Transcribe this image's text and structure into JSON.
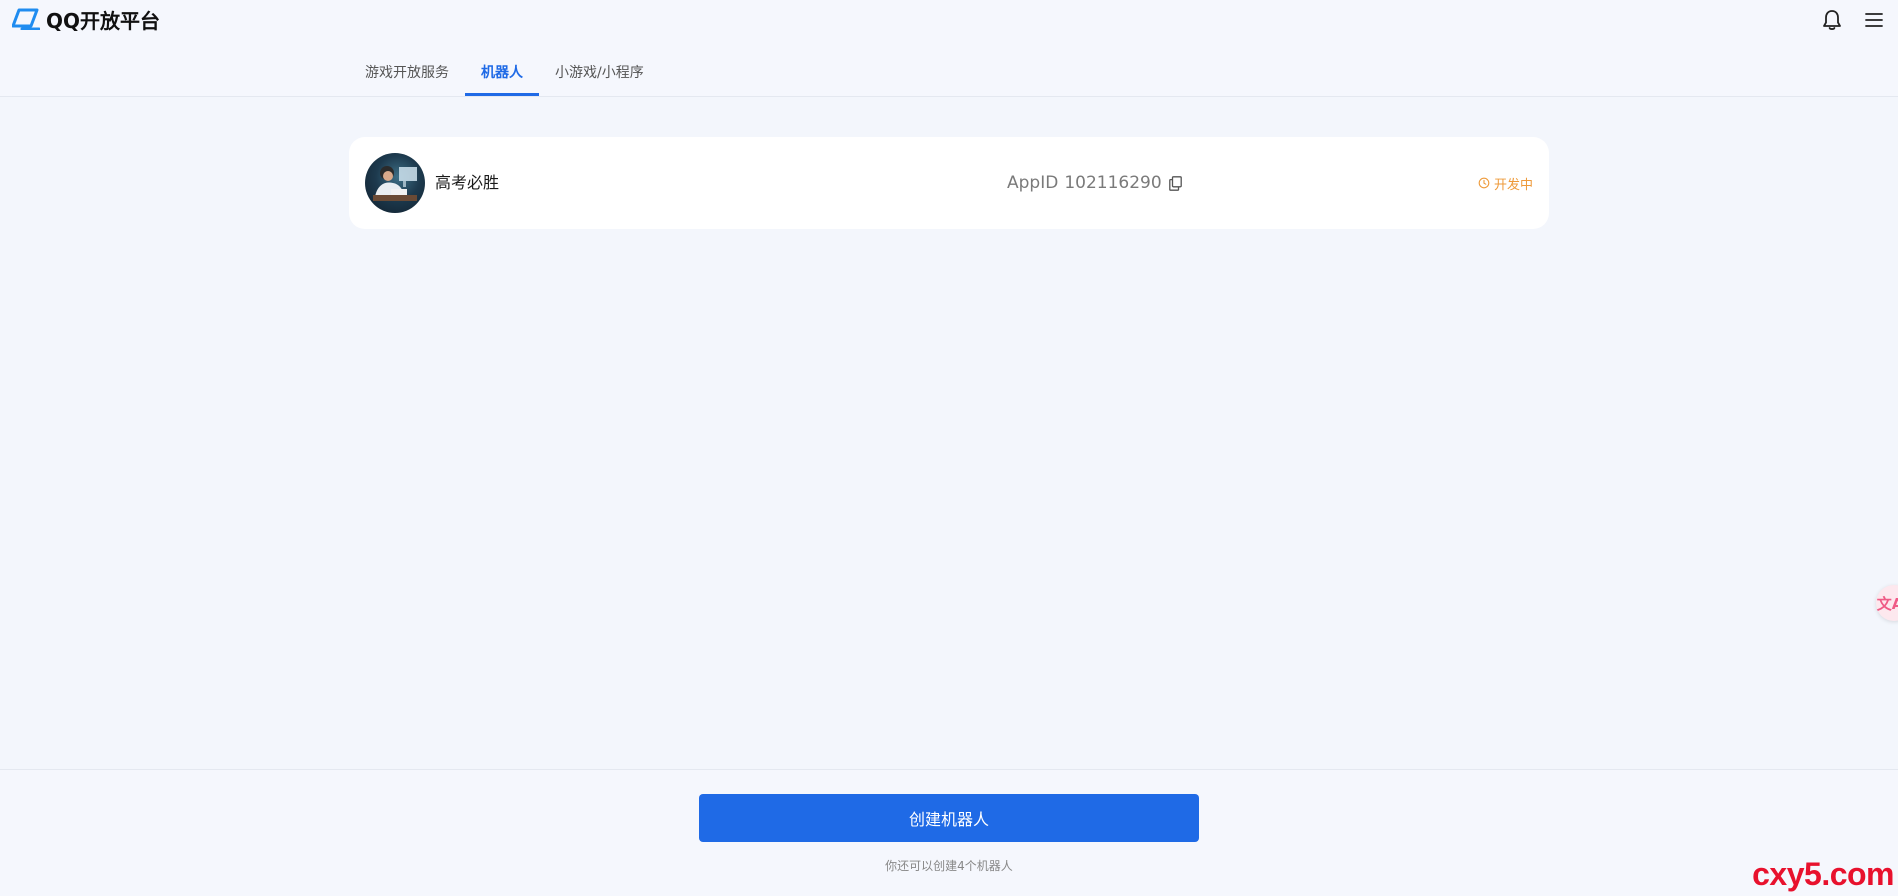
{
  "header": {
    "logo_text": "QQ开放平台",
    "icons": [
      "bell-icon",
      "menu-icon"
    ]
  },
  "tabs": [
    {
      "label": "游戏开放服务",
      "active": false
    },
    {
      "label": "机器人",
      "active": true
    },
    {
      "label": "小游戏/小程序",
      "active": false
    }
  ],
  "bot": {
    "name": "高考必胜",
    "appid_label": "AppID",
    "appid_value": "102116290",
    "status": "开发中"
  },
  "footer": {
    "create_button": "创建机器人",
    "hint": "你还可以创建4个机器人"
  },
  "watermark": "cxy5.com",
  "translate_fab_glyph": "文A",
  "colors": {
    "accent": "#1f6ae6",
    "status": "#ee9a3a",
    "background": "#f3f6fc",
    "watermark": "#e8112d"
  }
}
